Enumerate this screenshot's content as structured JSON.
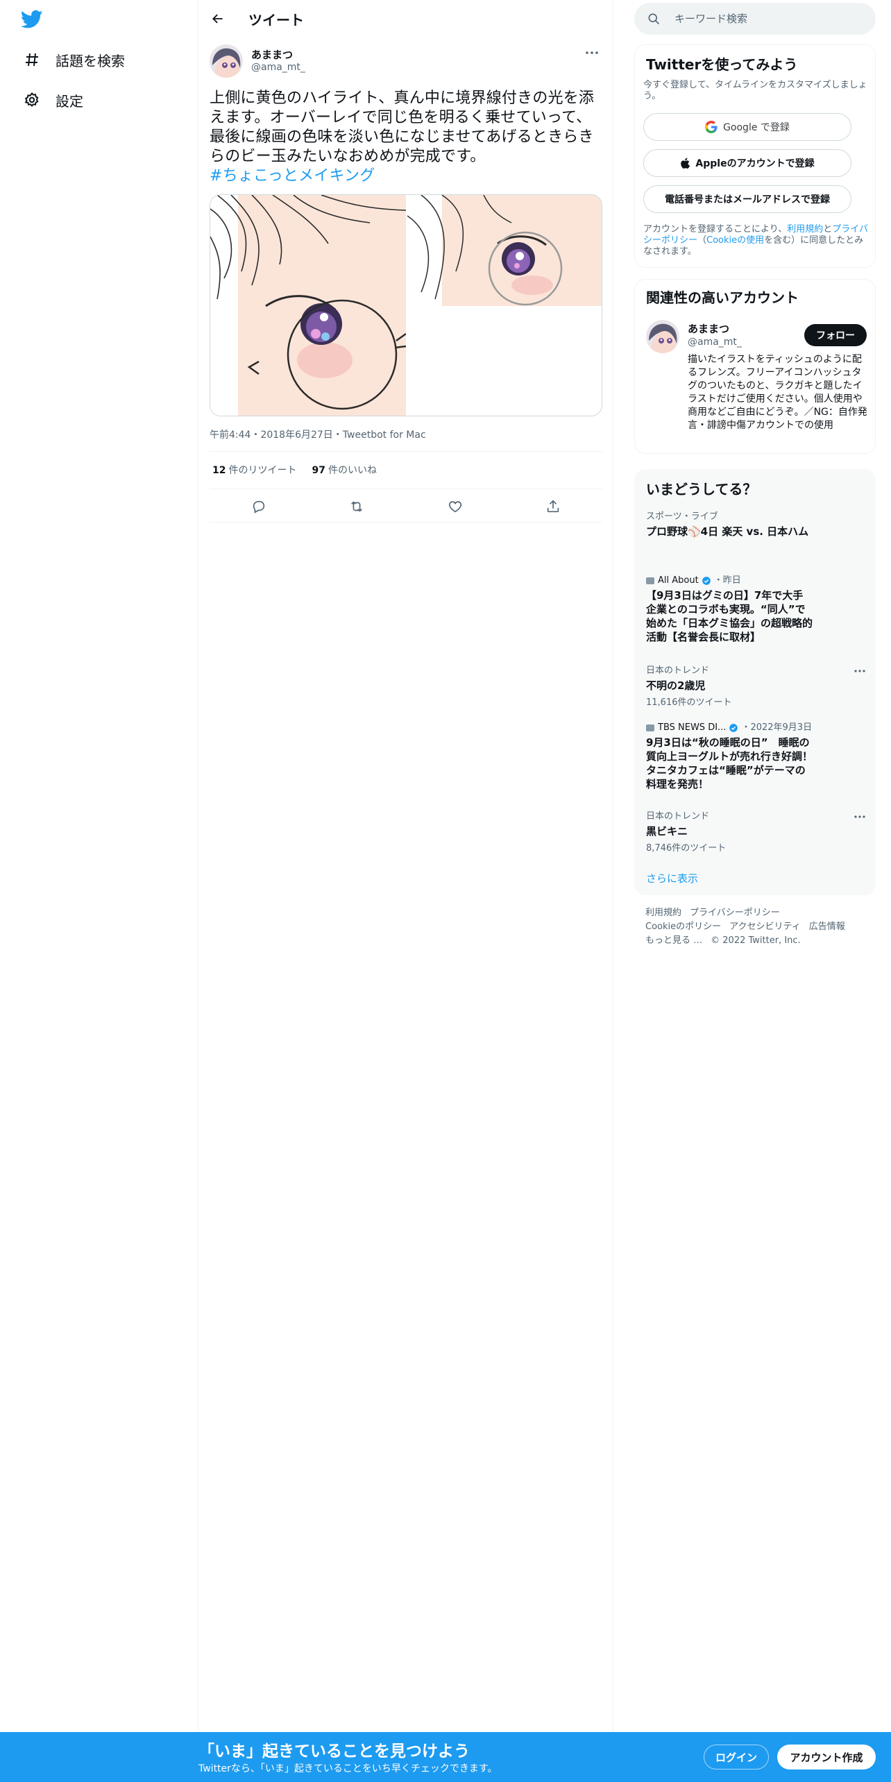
{
  "colors": {
    "accent": "#1d9bf0",
    "text": "#0f1419",
    "muted": "#536471",
    "banner": "#1d9bf0"
  },
  "icons": {
    "logo": "twitter-bird-icon",
    "explore": "hashtag-icon",
    "settings": "gear-icon",
    "back": "arrow-left-icon",
    "more": "ellipsis-icon",
    "search": "magnifier-icon",
    "reply": "speech-bubble-icon",
    "retweet": "retweet-icon",
    "like": "heart-icon",
    "share": "share-icon",
    "google": "google-g-icon",
    "apple": "apple-icon",
    "verified": "verified-badge-icon"
  },
  "sidebar": {
    "items": [
      {
        "label": "話題を検索"
      },
      {
        "label": "設定"
      }
    ]
  },
  "header": {
    "title": "ツイート"
  },
  "tweet": {
    "author_name": "あままつ",
    "author_handle": "@ama_mt_",
    "text": "上側に黄色のハイライト、真ん中に境界線付きの光を添えます。オーバーレイで同じ色を明るく乗せていって、最後に線画の色味を淡い色になじませてあげるときらきらのビー玉みたいなおめめが完成です。",
    "hashtag": "#ちょこっとメイキング",
    "meta": "午前4:44・2018年6月27日・Tweetbot for Mac",
    "retweets_count": "12",
    "retweets_label": "件のリツイート",
    "likes_count": "97",
    "likes_label": "件のいいね"
  },
  "search": {
    "placeholder": "キーワード検索"
  },
  "signup_card": {
    "title": "Twitterを使ってみよう",
    "subtitle": "今すぐ登録して、タイムラインをカスタマイズしましょう。",
    "google_label": "Google で登録",
    "apple_label": "Appleのアカウントで登録",
    "phone_label": "電話番号またはメールアドレスで登録",
    "terms_prefix": "アカウントを登録することにより、",
    "terms_link": "利用規約",
    "terms_and": "と",
    "privacy_link": "プライバシーポリシー",
    "cookie_open": "（",
    "cookie_link": "Cookieの使用",
    "terms_suffix": "を含む）に同意したとみなされます。"
  },
  "related": {
    "title": "関連性の高いアカウント",
    "name": "あままつ",
    "handle": "@ama_mt_",
    "follow_label": "フォロー",
    "bio": "描いたイラストをティッシュのように配るフレンズ。フリーアイコンハッシュタグのついたものと、ラクガキと題したイラストだけご使用ください。個人使用や商用などご自由にどうぞ。／NG：自作発言・誹謗中傷アカウントでの使用"
  },
  "trends": {
    "title": "いまどうしてる？",
    "items": [
      {
        "category": "スポーツ・ライブ",
        "title": "プロ野球⚾4日 楽天 vs. 日本ハム"
      },
      {
        "source": "All About",
        "time": "・昨日",
        "title": "【9月3日はグミの日】7年で大手企業とのコラボも実現。“同人”で始めた「日本グミ協会」の超戦略的活動【名誉会長に取材】"
      },
      {
        "category": "日本のトレンド",
        "title": "不明の2歳児",
        "count": "11,616件のツイート"
      },
      {
        "source": "TBS NEWS DI...",
        "time": "・2022年9月3日",
        "title": "9月3日は“秋の睡眠の日”　睡眠の質向上ヨーグルトが売れ行き好調！　タニタカフェは“睡眠”がテーマの料理を発売！"
      },
      {
        "category": "日本のトレンド",
        "title": "黒ビキニ",
        "count": "8,746件のツイート"
      }
    ],
    "show_more": "さらに表示"
  },
  "footer": {
    "links": [
      "利用規約",
      "プライバシーポリシー",
      "Cookieのポリシー",
      "アクセシビリティ",
      "広告情報",
      "もっと見る …"
    ],
    "copyright": "© 2022 Twitter, Inc."
  },
  "banner": {
    "title": "「いま」起きていることを見つけよう",
    "subtitle": "Twitterなら、「いま」起きていることをいち早くチェックできます。",
    "login_label": "ログイン",
    "signup_label": "アカウント作成"
  }
}
